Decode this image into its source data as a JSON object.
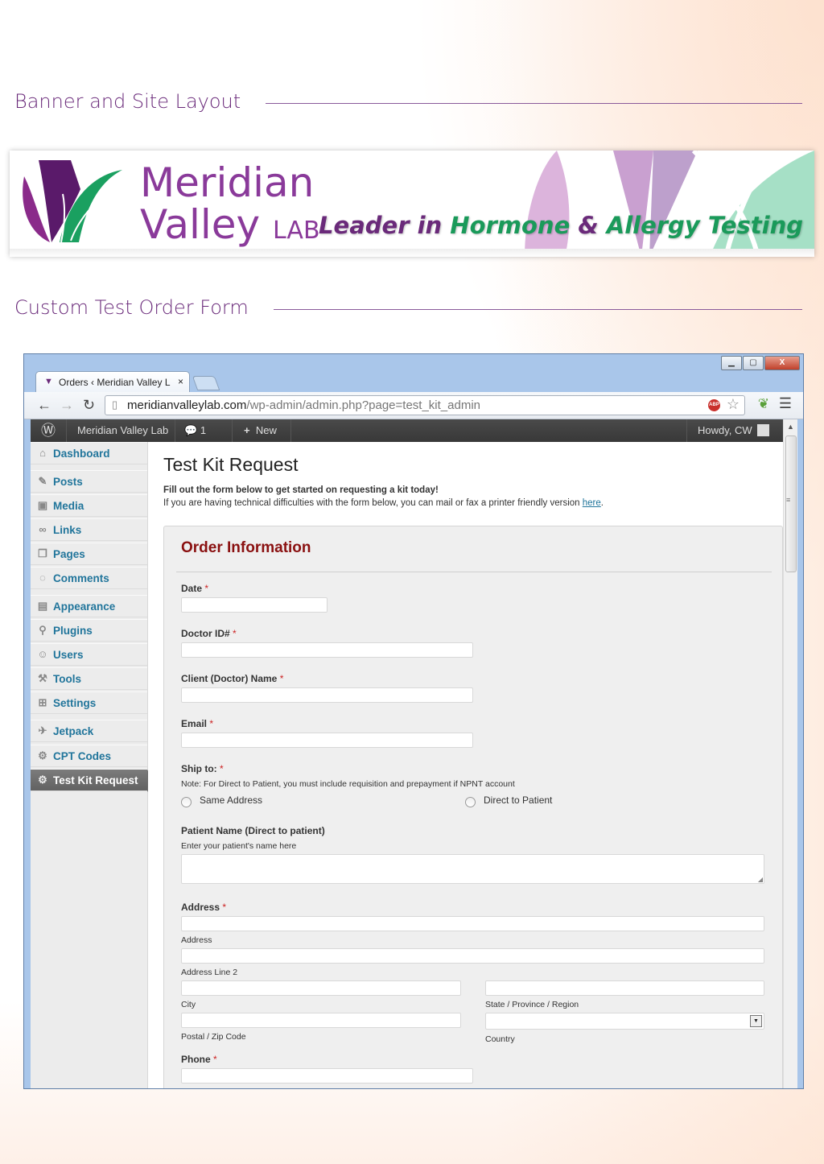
{
  "sections": {
    "banner_heading": "Banner and Site Layout",
    "form_heading": "Custom Test Order Form"
  },
  "banner": {
    "brand_line1": "Meridian",
    "brand_line2": "Valley",
    "brand_lab": "LAB",
    "tagline_part1": "Leader in",
    "tagline_part2": "Hormone",
    "tagline_part3": "&",
    "tagline_part4": "Allergy Testing",
    "colors": {
      "purple": "#6a2a7a",
      "green": "#1a9a5a"
    }
  },
  "browser": {
    "tab_title": "Orders ‹ Meridian Valley L",
    "tab_close": "×",
    "url_domain": "meridianvalleylab.com",
    "url_path": "/wp-admin/admin.php?page=test_kit_admin",
    "adblock_label": "ABP",
    "win_min": "▁",
    "win_max": "▢",
    "win_close": "X"
  },
  "adminbar": {
    "site_name": "Meridian Valley Lab",
    "comments_count": "1",
    "new_label": "New",
    "howdy": "Howdy, CW"
  },
  "sidebar": {
    "items": [
      {
        "label": "Dashboard",
        "icon": "dashboard-icon"
      },
      {
        "label": "Posts",
        "icon": "pin-icon"
      },
      {
        "label": "Media",
        "icon": "media-icon"
      },
      {
        "label": "Links",
        "icon": "link-icon"
      },
      {
        "label": "Pages",
        "icon": "pages-icon"
      },
      {
        "label": "Comments",
        "icon": "comment-icon"
      },
      {
        "label": "Appearance",
        "icon": "appearance-icon"
      },
      {
        "label": "Plugins",
        "icon": "plugin-icon"
      },
      {
        "label": "Users",
        "icon": "users-icon"
      },
      {
        "label": "Tools",
        "icon": "tools-icon"
      },
      {
        "label": "Settings",
        "icon": "settings-icon"
      },
      {
        "label": "Jetpack",
        "icon": "jetpack-icon"
      },
      {
        "label": "CPT Codes",
        "icon": "gear-icon"
      },
      {
        "label": "Test Kit Request",
        "icon": "gear-icon",
        "active": true
      }
    ]
  },
  "page": {
    "title": "Test Kit Request",
    "intro_bold": "Fill out the form below to get started on requesting a kit today!",
    "intro_text": "If you are having technical difficulties with the form below, you can mail or fax a printer friendly version",
    "intro_link": "here",
    "intro_end": "."
  },
  "form": {
    "heading": "Order Information",
    "required_mark": "*",
    "date_label": "Date",
    "doctor_id_label": "Doctor ID#",
    "client_name_label": "Client (Doctor) Name",
    "email_label": "Email",
    "ship_to_label": "Ship to:",
    "ship_note": "Note: For Direct to Patient, you must include requisition and prepayment if NPNT account",
    "ship_option_same": "Same Address",
    "ship_option_direct": "Direct to Patient",
    "patient_name_label": "Patient Name (Direct to patient)",
    "patient_name_help": "Enter your patient's name here",
    "address_label": "Address",
    "address_sub": "Address",
    "address2_sub": "Address Line 2",
    "city_sub": "City",
    "state_sub": "State / Province / Region",
    "zip_sub": "Postal / Zip Code",
    "country_sub": "Country",
    "phone_label": "Phone"
  }
}
